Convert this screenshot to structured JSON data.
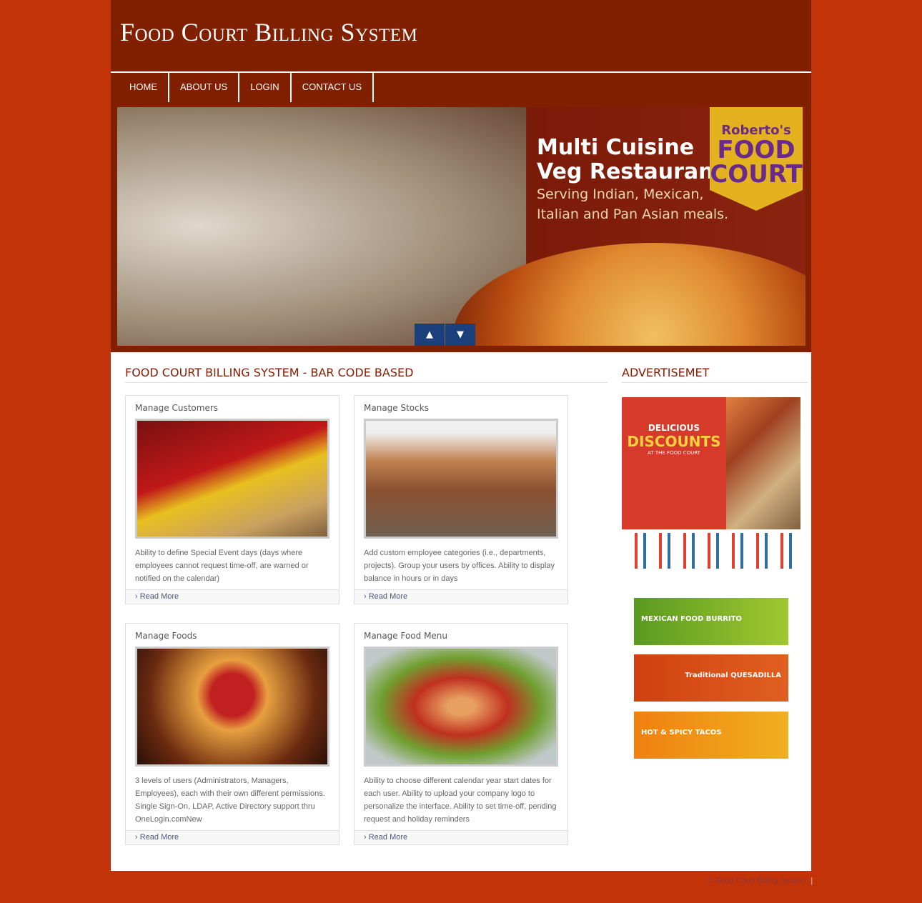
{
  "header": {
    "title": "Food Court Billing System"
  },
  "nav": [
    "HOME",
    "ABOUT US",
    "LOGIN",
    "CONTACT US"
  ],
  "slider": {
    "headline1": "Multi Cuisine",
    "headline2": "Veg Restaurant",
    "sub1": "Serving Indian, Mexican,",
    "sub2": "Italian and Pan Asian meals.",
    "logo_line1": "Roberto's",
    "logo_line2": "FOOD",
    "logo_line3": "COURT",
    "prev": "▲",
    "next": "▼"
  },
  "main": {
    "title": "FOOD COURT BILLING SYSTEM - BAR CODE BASED",
    "boxes": [
      {
        "title": "Manage Customers",
        "text": "Ability to define Special Event days (days where employees cannot request time-off, are warned or notified on the calendar)",
        "more": "Read More"
      },
      {
        "title": "Manage Stocks",
        "text": "Add custom employee categories (i.e., departments, projects). Group your users by offices. Ability to display balance in hours or in days",
        "more": "Read More"
      },
      {
        "title": "Manage Foods",
        "text": "3 levels of users (Administrators, Managers, Employees), each with their own different permissions. Single Sign-On, LDAP, Active Directory support thru OneLogin.comNew",
        "more": "Read More"
      },
      {
        "title": "Manage Food Menu",
        "text": "Ability to choose different calendar year start dates for each user. Ability to upload your company logo to personalize the interface. Ability to set time-off, pending request and holiday reminders",
        "more": "Read More"
      }
    ]
  },
  "sidebar": {
    "title": "ADVERTISEMET",
    "ad_text1": "DELICIOUS",
    "ad_text2": "DISCOUNTS",
    "ad_text3": "AT THE FOOD COURT",
    "banners": [
      "MEXICAN FOOD BURRITO",
      "Traditional QUESADILLA",
      "HOT & SPICY TACOS"
    ]
  },
  "footer": {
    "copyright": "© Food Court Billing System",
    "sep": "|"
  }
}
